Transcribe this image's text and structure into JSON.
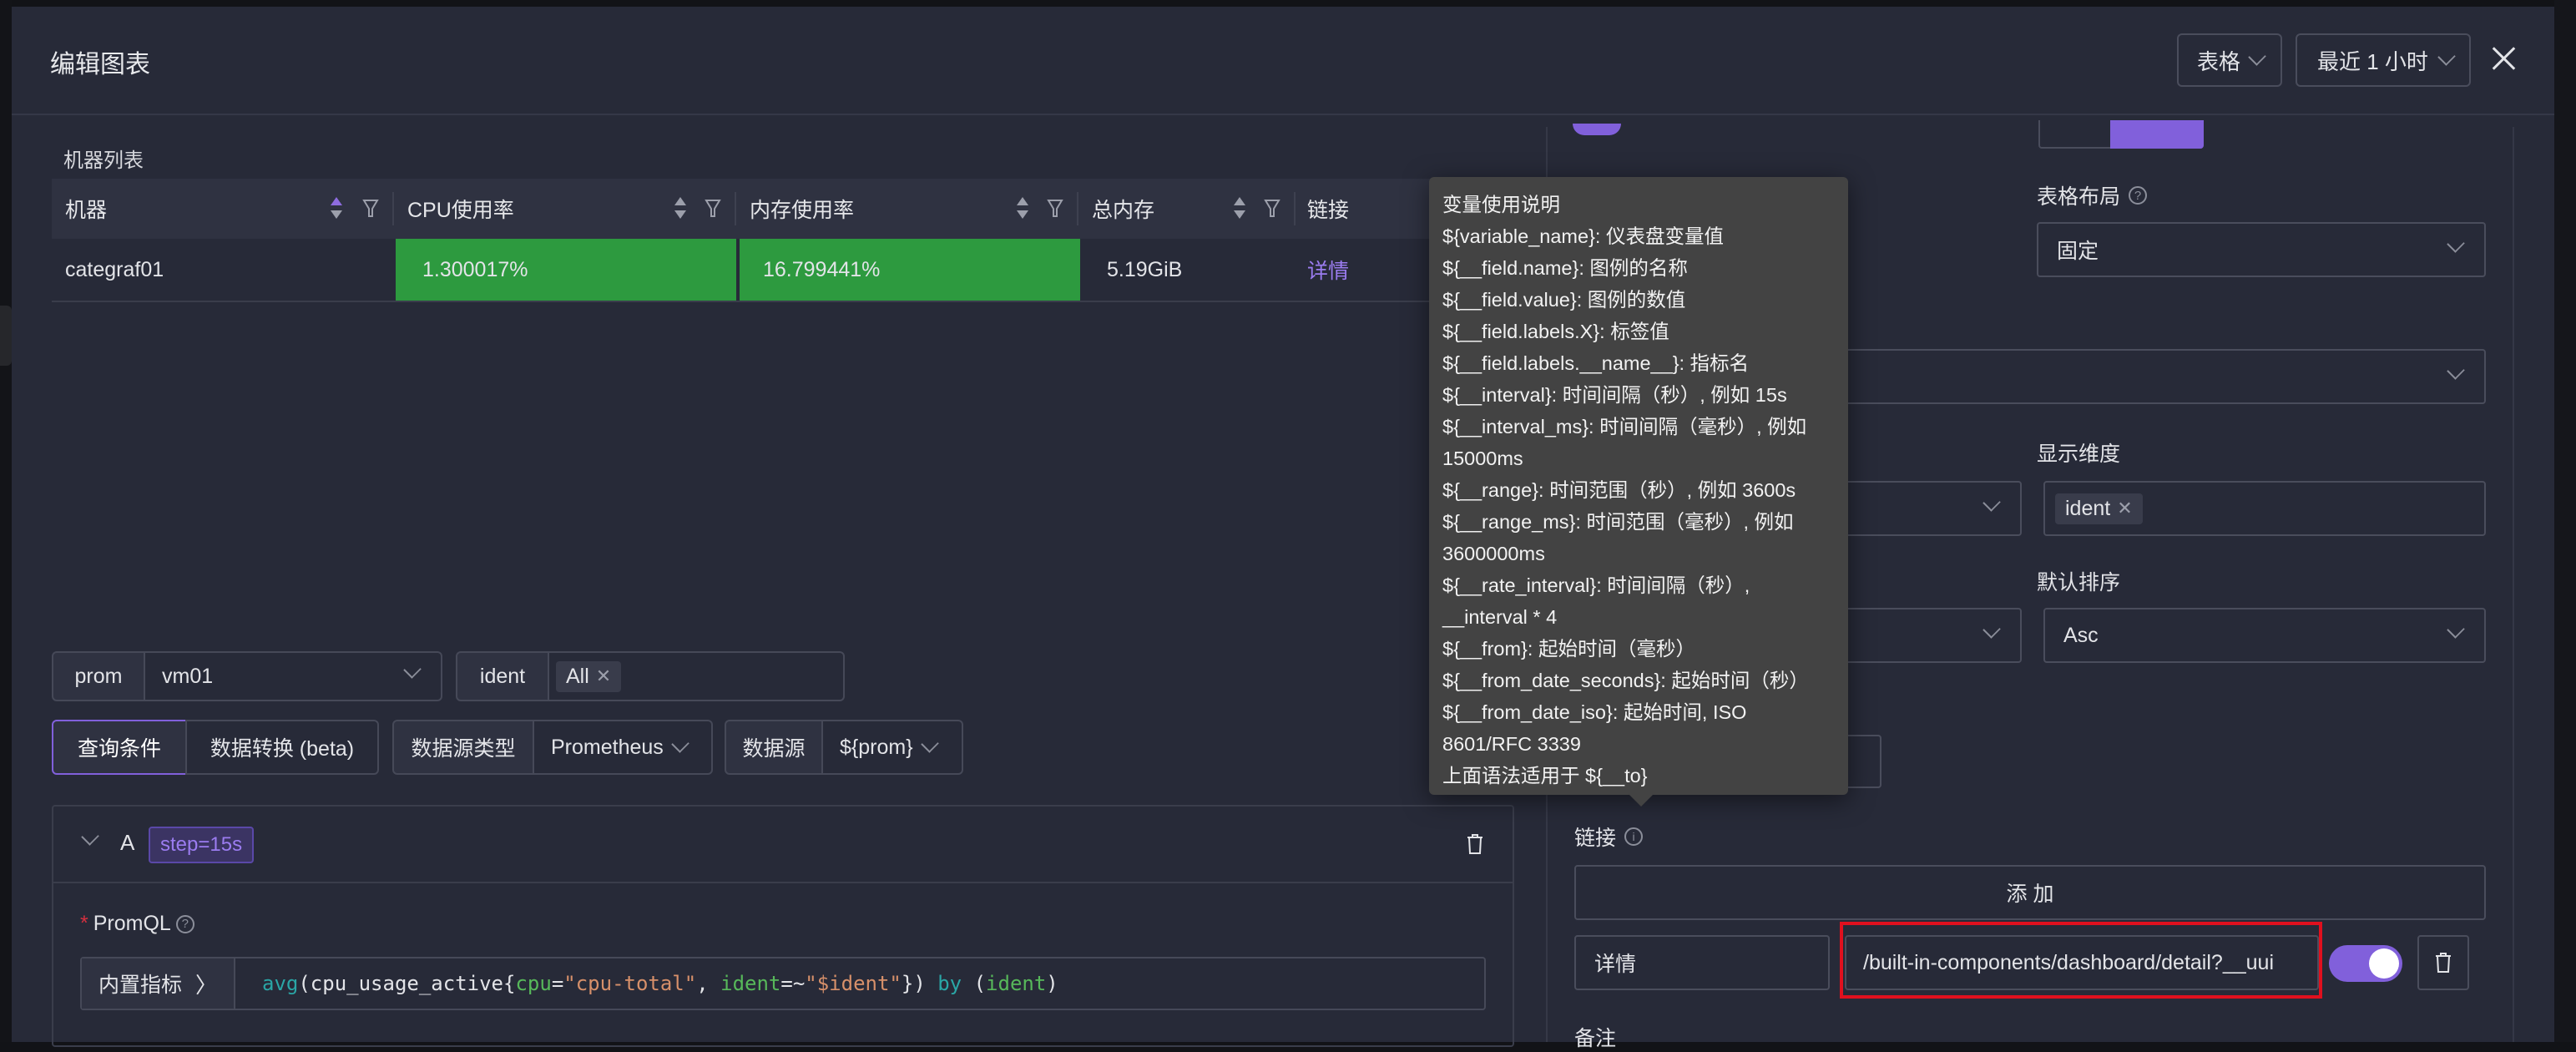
{
  "modal": {
    "title": "编辑图表",
    "chart_type": "表格",
    "time_range": "最近 1 小时"
  },
  "table": {
    "title": "机器列表",
    "columns": [
      "机器",
      "CPU使用率",
      "内存使用率",
      "总内存",
      "链接"
    ],
    "rows": [
      {
        "machine": "categraf01",
        "cpu": "1.300017%",
        "mem": "16.799441%",
        "total_mem": "5.19GiB",
        "link": "详情"
      }
    ],
    "status_color": "#2d9a3f"
  },
  "variables": [
    {
      "name": "prom",
      "value": "vm01"
    },
    {
      "name": "ident",
      "value": "All"
    }
  ],
  "tabs": {
    "query": "查询条件",
    "transform": "数据转换 (beta)"
  },
  "datasource": {
    "type_label": "数据源类型",
    "type_value": "Prometheus",
    "source_label": "数据源",
    "source_value": "${prom}"
  },
  "query": {
    "ref": "A",
    "step": "step=15s",
    "promql_label": "PromQL",
    "builtin_label": "内置指标",
    "expr": {
      "fn": "avg",
      "metric": "(cpu_usage_active{",
      "l1": "cpu",
      "op1": "=",
      "v1": "\"cpu-total\"",
      "sep": ", ",
      "l2": "ident",
      "op2": "=~",
      "v2": "\"$ident\"",
      "close": "}) ",
      "by": "by",
      "by_open": " (",
      "by_label": "ident",
      "by_close": ")"
    }
  },
  "right_panel": {
    "table_layout_label": "表格布局",
    "table_layout_value": "固定",
    "display_dim_label": "显示维度",
    "display_dim_tag": "ident",
    "default_sort_label": "默认排序",
    "default_sort_value": "Asc",
    "links_label": "链接",
    "add_button": "添 加",
    "link_name": "详情",
    "link_url": "/built-in-components/dashboard/detail?__uui",
    "link_enabled": true,
    "note_label": "备注"
  },
  "tooltip": {
    "lines": [
      "变量使用说明",
      "${variable_name}: 仪表盘变量值",
      "${__field.name}: 图例的名称",
      "${__field.value}: 图例的数值",
      "${__field.labels.X}: 标签值",
      "${__field.labels.__name__}: 指标名",
      "${__interval}: 时间间隔（秒）, 例如 15s",
      "${__interval_ms}: 时间间隔（毫秒）, 例如",
      "15000ms",
      "${__range}: 时间范围（秒）, 例如 3600s",
      "${__range_ms}: 时间范围（毫秒）, 例如",
      "3600000ms",
      "${__rate_interval}: 时间间隔（秒）,",
      "__interval * 4",
      "${__from}: 起始时间（毫秒）",
      "${__from_date_seconds}: 起始时间（秒）",
      "${__from_date_iso}: 起始时间, ISO",
      "8601/RFC 3339",
      "上面语法适用于 ${__to}"
    ]
  },
  "colors": {
    "accent": "#8160db",
    "ok_green": "#2d9a3f",
    "highlight_red": "#e0101e"
  }
}
